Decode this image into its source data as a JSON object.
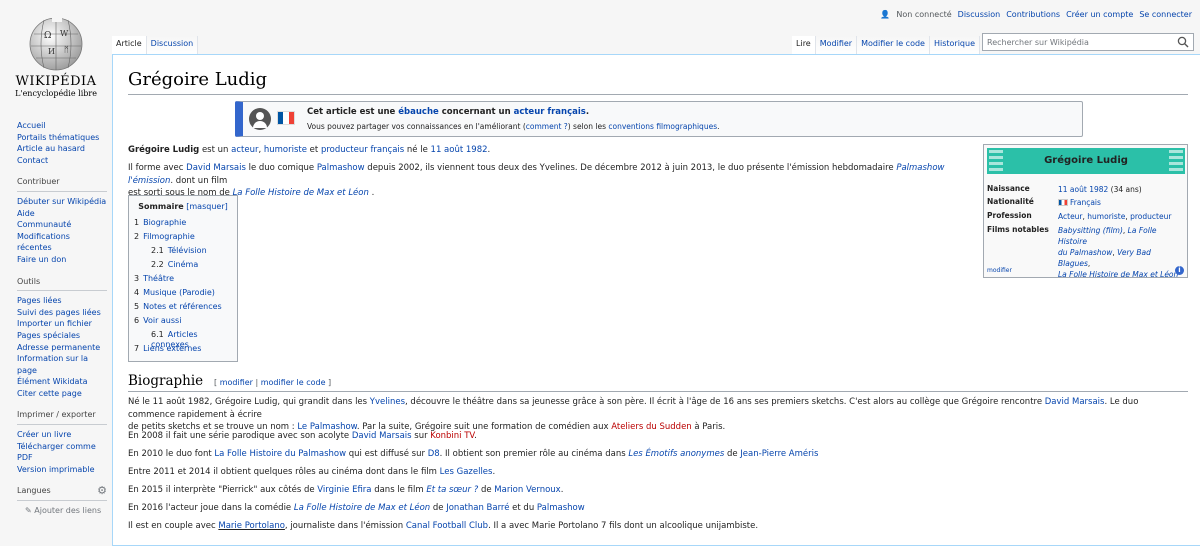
{
  "logo": {
    "wordmark": "WIKIPÉDIA",
    "tagline": "L'encyclopédie libre"
  },
  "sidebar": {
    "nav": [
      "Accueil",
      "Portails thématiques",
      "Article au hasard",
      "Contact"
    ],
    "contribute": {
      "heading": "Contribuer",
      "items": [
        "Débuter sur Wikipédia",
        "Aide",
        "Communauté",
        "Modifications récentes",
        "Faire un don"
      ]
    },
    "tools": {
      "heading": "Outils",
      "items": [
        "Pages liées",
        "Suivi des pages liées",
        "Importer un fichier",
        "Pages spéciales",
        "Adresse permanente",
        "Information sur la page",
        "Élément Wikidata",
        "Citer cette page"
      ]
    },
    "print": {
      "heading": "Imprimer / exporter",
      "items": [
        "Créer un livre",
        "Télécharger comme",
        "PDF",
        "Version imprimable"
      ]
    },
    "languages": {
      "heading": "Langues",
      "add_links": "Ajouter des liens"
    }
  },
  "personal": {
    "not_connected": "Non connecté",
    "discussion": "Discussion",
    "contributions": "Contributions",
    "create_account": "Créer un compte",
    "login": "Se connecter"
  },
  "tabs": {
    "article": "Article",
    "discussion": "Discussion",
    "read": "Lire",
    "edit": "Modifier",
    "edit_code": "Modifier le code",
    "history": "Historique"
  },
  "search": {
    "placeholder": "Rechercher sur Wikipédia"
  },
  "page_title": "Grégoire Ludig",
  "stub": {
    "t1_a": "Cet article est une ",
    "t1_link1": "ébauche",
    "t1_b": " concernant un ",
    "t1_link2": "acteur français",
    "t1_c": ".",
    "t2_a": "Vous pouvez partager vos connaissances en l'améliorant (",
    "t2_link1": "comment ?",
    "t2_b": ") selon les ",
    "t2_link2": "conventions filmographiques",
    "t2_c": "."
  },
  "flag_colors": [
    "#0055a4",
    "#ffffff",
    "#ef4135"
  ],
  "intro": {
    "p1": {
      "name": "Grégoire Ludig",
      "a": " est un ",
      "l1": "acteur",
      "b": ", ",
      "l2": "humoriste",
      "c": " et ",
      "l3": "producteur français",
      "d": " né le ",
      "l4": "11 août 1982",
      "e": "."
    },
    "p2": {
      "a": "Il forme avec ",
      "l1": "David Marsais",
      "b": " le duo comique ",
      "l2": "Palmashow",
      "c": " depuis 2002, ils viennent tous deux des Yvelines. De décembre 2012 à juin 2013, le duo présente l'émission hebdomadaire ",
      "l3": "Palmashow l'émission",
      "d": ". dont un film",
      "e": "est sorti sous le nom de ",
      "l4": "La Folle Histoire de Max et Léon",
      "f": " ."
    }
  },
  "infobox": {
    "title": "Grégoire Ludig",
    "rows": [
      {
        "k": "Naissance",
        "v1": "11 août 1982",
        "v2": " (34 ans)"
      },
      {
        "k": "Nationalité",
        "v1": "Français"
      },
      {
        "k": "Profession",
        "v1": "Acteur",
        "v2": ", ",
        "v3": "humoriste",
        "v4": ", ",
        "v5": "producteur"
      },
      {
        "k": "Films notables",
        "l1": "Babysitting (film)",
        "s1": ", ",
        "l2": "La Folle Histoire",
        "l2b": "du Palmashow",
        "s2": ", ",
        "l3": "Very Bad Blagues",
        "s3": ",",
        "l4": "La Folle Histoire de Max et Léon"
      }
    ],
    "footer": "modifier",
    "info_icon": "i"
  },
  "toc": {
    "title": "Sommaire",
    "toggle": "[masquer]",
    "items": [
      {
        "n": "1",
        "t": "Biographie"
      },
      {
        "n": "2",
        "t": "Filmographie"
      },
      {
        "n": "2.1",
        "t": "Télévision"
      },
      {
        "n": "2.2",
        "t": "Cinéma"
      },
      {
        "n": "3",
        "t": "Théâtre"
      },
      {
        "n": "4",
        "t": "Musique (Parodie)"
      },
      {
        "n": "5",
        "t": "Notes et références"
      },
      {
        "n": "6",
        "t": "Voir aussi"
      },
      {
        "n": "6.1",
        "t": "Articles connexes"
      },
      {
        "n": "7",
        "t": "Liens externes"
      }
    ]
  },
  "bio": {
    "heading": "Biographie",
    "edit_open": "[ ",
    "edit1": "modifier",
    "edit_sep": " | ",
    "edit2": "modifier le code",
    "edit_close": " ]",
    "p1": {
      "a": "Né le 11 août 1982, Grégoire Ludig, qui grandit dans les ",
      "l1": "Yvelines",
      "b": ", découvre le théâtre dans sa jeunesse grâce à son père. Il écrit à l'âge de 16 ans ses premiers sketchs. C'est alors au collège que Grégoire rencontre ",
      "l2": "David Marsais",
      "c": ". Le duo commence rapidement à écrire",
      "d": "de petits sketchs et se trouve un nom : ",
      "l3": "Le Palmashow",
      "e": ". Par la suite, Grégoire suit une formation de comédien aux ",
      "l4": "Ateliers du Sudden",
      "f": " à Paris."
    },
    "p2": {
      "a": "En 2008 il fait une série parodique avec son acolyte ",
      "l1": "David Marsais",
      "b": " sur ",
      "l2": "Konbini TV",
      "c": "."
    },
    "p3": {
      "a": "En 2010 le duo font ",
      "l1": "La Folle Histoire du Palmashow",
      "b": " qui est diffusé sur ",
      "l2": "D8",
      "c": ". Il obtient son premier rôle au cinéma dans ",
      "l3": "Les Émotifs anonymes",
      "d": " de ",
      "l4": "Jean-Pierre Améris"
    },
    "p4": {
      "a": "Entre 2011 et 2014 il obtient quelques rôles au cinéma dont dans le film ",
      "l1": "Les Gazelles",
      "b": "."
    },
    "p5": {
      "a": "En 2015 il interprète \"Pierrick\" aux côtés de ",
      "l1": "Virginie Efira",
      "b": " dans le film ",
      "l2": "Et ta sœur ?",
      "c": " de ",
      "l3": "Marion Vernoux",
      "d": "."
    },
    "p6": {
      "a": "En 2016 l'acteur joue dans la comédie ",
      "l1": "La Folle Histoire de Max et Léon",
      "b": " de ",
      "l2": "Jonathan Barré",
      "c": " et du ",
      "l3": "Palmashow"
    },
    "p7": {
      "a": "Il est en couple avec ",
      "l1": "Marie Portolano",
      "b": ", journaliste dans l'émission ",
      "l2": "Canal Football Club",
      "c": ". Il a avec Marie Portolano 7 fils dont un alcoolique unijambiste."
    }
  }
}
